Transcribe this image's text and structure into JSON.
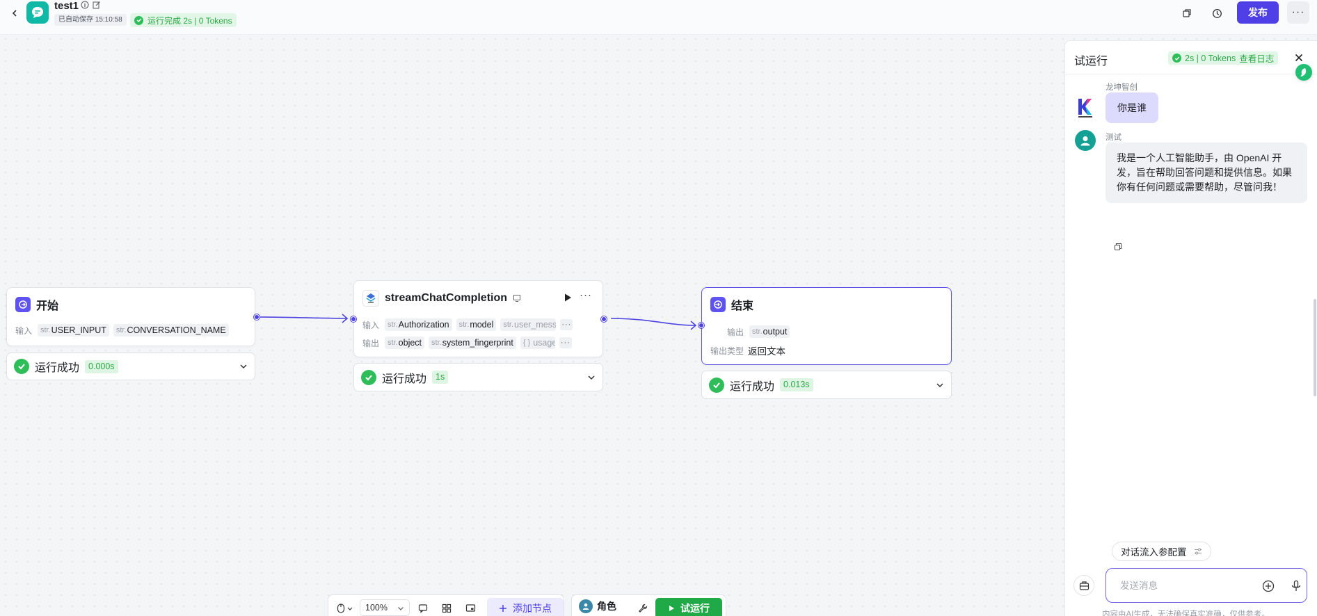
{
  "header": {
    "title": "test1",
    "autosave": "已自动保存 15:10:58",
    "run_status": "运行完成 2s | 0 Tokens",
    "publish_label": "发布",
    "more_label": "···"
  },
  "nodes": {
    "start": {
      "title": "开始",
      "input_label": "输入",
      "inputs": [
        {
          "type": "str.",
          "name": "USER_INPUT"
        },
        {
          "type": "str.",
          "name": "CONVERSATION_NAME"
        }
      ],
      "status": "运行成功",
      "time": "0.000s"
    },
    "llm": {
      "title": "streamChatCompletion",
      "input_label": "输入",
      "output_label": "输出",
      "inputs": [
        {
          "type": "str.",
          "name": "Authorization"
        },
        {
          "type": "str.",
          "name": "model"
        },
        {
          "type": "str.",
          "name": "user_mess"
        }
      ],
      "outputs": [
        {
          "type": "str.",
          "name": "object"
        },
        {
          "type": "str.",
          "name": "system_fingerprint"
        },
        {
          "type": "{ }",
          "name": "usage"
        }
      ],
      "more": "···",
      "status": "运行成功",
      "time": "1s"
    },
    "end": {
      "title": "结束",
      "output_label": "输出",
      "output": {
        "type": "str.",
        "name": "output"
      },
      "output_type_label": "输出类型",
      "output_type_value": "返回文本",
      "status": "运行成功",
      "time": "0.013s"
    }
  },
  "toolbar": {
    "zoom": "100%",
    "add_node": "添加节点",
    "role": "角色",
    "trial_run": "试运行"
  },
  "panel": {
    "title": "试运行",
    "badge": "2s | 0 Tokens",
    "view_log": "查看日志",
    "messages": [
      {
        "sender": "龙坤智创",
        "text": "你是谁"
      },
      {
        "sender": "测试",
        "text": "我是一个人工智能助手，由 OpenAI 开发，旨在帮助回答问题和提供信息。如果你有任何问题或需要帮助，尽管问我！"
      }
    ],
    "param_button": "对话流入参配置",
    "input_placeholder": "发送消息",
    "disclaimer": "内容由AI生成，无法确保真实准确，仅供参考。"
  },
  "colors": {
    "accent": "#4e40e6",
    "success": "#2fbd5a",
    "edge": "#4e43e0"
  }
}
